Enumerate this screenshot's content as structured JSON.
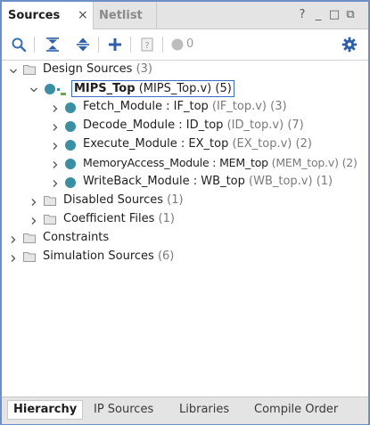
{
  "tabs": {
    "sources": "Sources",
    "close": "×",
    "netlist": "Netlist"
  },
  "window_controls": {
    "help": "?",
    "minimize": "_",
    "restore": "□",
    "maximize": "⧉"
  },
  "toolbar": {
    "status_count": "0"
  },
  "tree": {
    "design_sources": {
      "label": "Design Sources",
      "count": "(3)"
    },
    "mips_top": {
      "name": "MIPS_Top",
      "file": "(MIPS_Top.v)",
      "count": "(5)"
    },
    "modules": [
      {
        "name": "Fetch_Module : IF_top",
        "file": "(IF_top.v)",
        "count": "(3)"
      },
      {
        "name": "Decode_Module : ID_top",
        "file": "(ID_top.v)",
        "count": "(7)"
      },
      {
        "name": "Execute_Module : EX_top",
        "file": "(EX_top.v)",
        "count": "(2)"
      },
      {
        "name": "MemoryAccess_Module : MEM_top",
        "file": "(MEM_top.v)",
        "count": "(2)"
      },
      {
        "name": "WriteBack_Module : WB_top",
        "file": "(WB_top.v)",
        "count": "(1)"
      }
    ],
    "disabled_sources": {
      "label": "Disabled Sources",
      "count": "(1)"
    },
    "coefficient_files": {
      "label": "Coefficient Files",
      "count": "(1)"
    },
    "constraints": {
      "label": "Constraints"
    },
    "simulation_sources": {
      "label": "Simulation Sources",
      "count": "(6)"
    }
  },
  "bottom_tabs": [
    "Hierarchy",
    "IP Sources",
    "Libraries",
    "Compile Order"
  ],
  "colors": {
    "accent_border": "#6d8fc7",
    "module_dot": "#3a8fa3",
    "icon_blue": "#3b6fb6"
  }
}
